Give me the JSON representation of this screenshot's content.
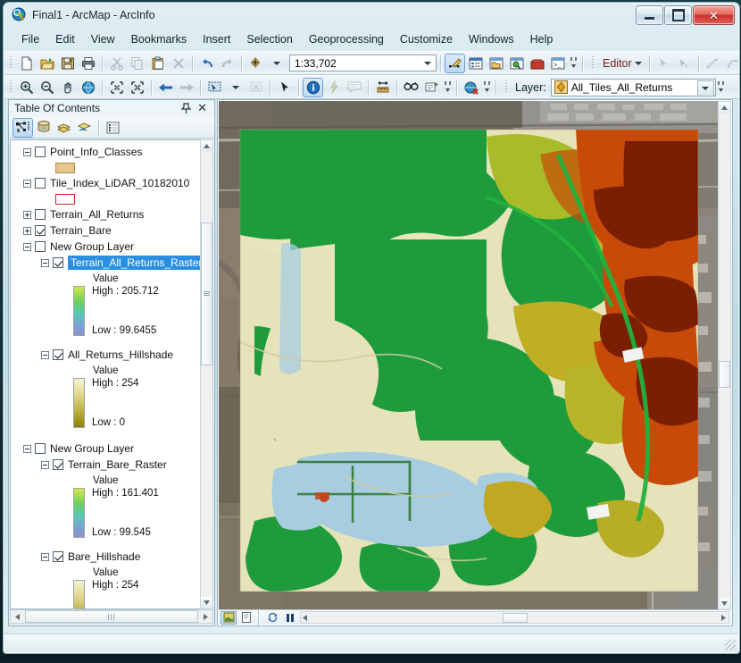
{
  "window": {
    "title": "Final1 - ArcMap - ArcInfo",
    "app_icon": "arcmap-globe-icon",
    "minimize_label": "Minimize",
    "maximize_label": "Maximize",
    "close_label": "Close"
  },
  "menu": {
    "items": [
      {
        "label": "File",
        "name": "menu-file"
      },
      {
        "label": "Edit",
        "name": "menu-edit"
      },
      {
        "label": "View",
        "name": "menu-view"
      },
      {
        "label": "Bookmarks",
        "name": "menu-bookmarks"
      },
      {
        "label": "Insert",
        "name": "menu-insert"
      },
      {
        "label": "Selection",
        "name": "menu-selection"
      },
      {
        "label": "Geoprocessing",
        "name": "menu-geoprocessing"
      },
      {
        "label": "Customize",
        "name": "menu-customize"
      },
      {
        "label": "Windows",
        "name": "menu-windows"
      },
      {
        "label": "Help",
        "name": "menu-help"
      }
    ]
  },
  "standard_toolbar": {
    "scale_value": "1:33,702",
    "editor_label": "Editor",
    "icons": [
      "new-document-icon",
      "open-folder-icon",
      "save-icon",
      "print-icon",
      "cut-icon",
      "copy-icon",
      "paste-icon",
      "delete-icon",
      "undo-icon",
      "redo-icon",
      "add-data-icon"
    ],
    "right_icons": [
      "editor-toolbar-icon",
      "table-of-contents-icon",
      "catalog-icon",
      "search-icon",
      "toolbox-icon",
      "python-window-icon"
    ],
    "editor_icons": [
      "edit-tool-icon",
      "edit-annotation-icon",
      "straight-segment-icon",
      "curve-segment-icon",
      "construction-tools-icon"
    ]
  },
  "tools_toolbar": {
    "layer_label": "Layer:",
    "layer_value": "All_Tiles_All_Returns",
    "icons": [
      "zoom-in-icon",
      "zoom-out-icon",
      "pan-icon",
      "full-extent-icon",
      "fixed-zoom-in-icon",
      "fixed-zoom-out-icon",
      "go-back-extent-icon",
      "go-forward-extent-icon",
      "select-features-icon",
      "clear-selection-icon",
      "select-elements-icon",
      "identify-icon",
      "hyperlink-icon",
      "html-popup-icon",
      "measure-icon",
      "find-icon",
      "go-to-xy-icon",
      "time-slider-icon",
      "create-viewer-icon"
    ]
  },
  "table_of_contents": {
    "title": "Table Of Contents",
    "pin_icon": "pin-icon",
    "close_icon": "close-icon",
    "tool_icons": [
      "list-by-drawing-order-icon",
      "list-by-source-icon",
      "list-by-visibility-icon",
      "list-by-selection-icon",
      "options-icon"
    ],
    "layers": [
      {
        "name": "Point_Info_Classes",
        "checked": false,
        "expanded": true,
        "indent": 0,
        "swatch": "#e8c48f",
        "swatch_border": "#b08a56"
      },
      {
        "name": "Tile_Index_LiDAR_10182010",
        "checked": false,
        "expanded": true,
        "indent": 0,
        "swatch": "#ffffff",
        "swatch_border": "#cc2222"
      },
      {
        "name": "Terrain_All_Returns",
        "checked": false,
        "expanded": false,
        "indent": 0
      },
      {
        "name": "Terrain_Bare",
        "checked": true,
        "expanded": false,
        "indent": 0
      },
      {
        "name": "New Group Layer",
        "checked": false,
        "expanded": true,
        "indent": 0
      },
      {
        "name": "Terrain_All_Returns_Raster",
        "checked": true,
        "expanded": true,
        "indent": 1,
        "selected": true,
        "legend": {
          "value_label": "Value",
          "high_label": "High : 205.712",
          "low_label": "Low : 99.6455",
          "ramp": [
            "#d4e84a",
            "#6fcf5a",
            "#56c9b4",
            "#7f9fd4",
            "#8e92c8"
          ]
        }
      },
      {
        "name": "All_Returns_Hillshade",
        "checked": true,
        "expanded": true,
        "indent": 1,
        "legend": {
          "value_label": "Value",
          "high_label": "High : 254",
          "low_label": "Low : 0",
          "ramp": [
            "#f7f3d0",
            "#d9cf71",
            "#a79c1f",
            "#8a8109"
          ]
        }
      },
      {
        "name": "New Group Layer",
        "checked": false,
        "expanded": true,
        "indent": 0
      },
      {
        "name": "Terrain_Bare_Raster",
        "checked": true,
        "expanded": true,
        "indent": 1,
        "legend": {
          "value_label": "Value",
          "high_label": "High : 161.401",
          "low_label": "Low : 99.545",
          "ramp": [
            "#d4e84a",
            "#6fcf5a",
            "#56c9b4",
            "#7f9fd4",
            "#8e92c8"
          ]
        }
      },
      {
        "name": "Bare_Hillshade",
        "checked": true,
        "expanded": true,
        "indent": 1,
        "legend": {
          "value_label": "Value",
          "high_label": "High : 254",
          "low_label": "",
          "ramp": [
            "#f7f3d0",
            "#d9cf71",
            "#a79c1f",
            "#8a8109"
          ]
        }
      }
    ]
  },
  "map": {
    "view_buttons": [
      {
        "name": "data-view-button",
        "icon": "data-view-icon",
        "selected": true
      },
      {
        "name": "layout-view-button",
        "icon": "layout-view-icon",
        "selected": false
      }
    ],
    "refresh_icon": "refresh-icon",
    "pause_icon": "pause-drawing-icon",
    "basemap": "aerial-imagery",
    "raster_colors": {
      "highest": "#7a1f04",
      "high": "#c84a09",
      "mid_high": "#d4a017",
      "mid": "#a8bc2a",
      "mid_low": "#1e9c3c",
      "low": "#e8e5bd",
      "lowest": "#a8cde0"
    }
  },
  "statusbar": {
    "text": ""
  }
}
